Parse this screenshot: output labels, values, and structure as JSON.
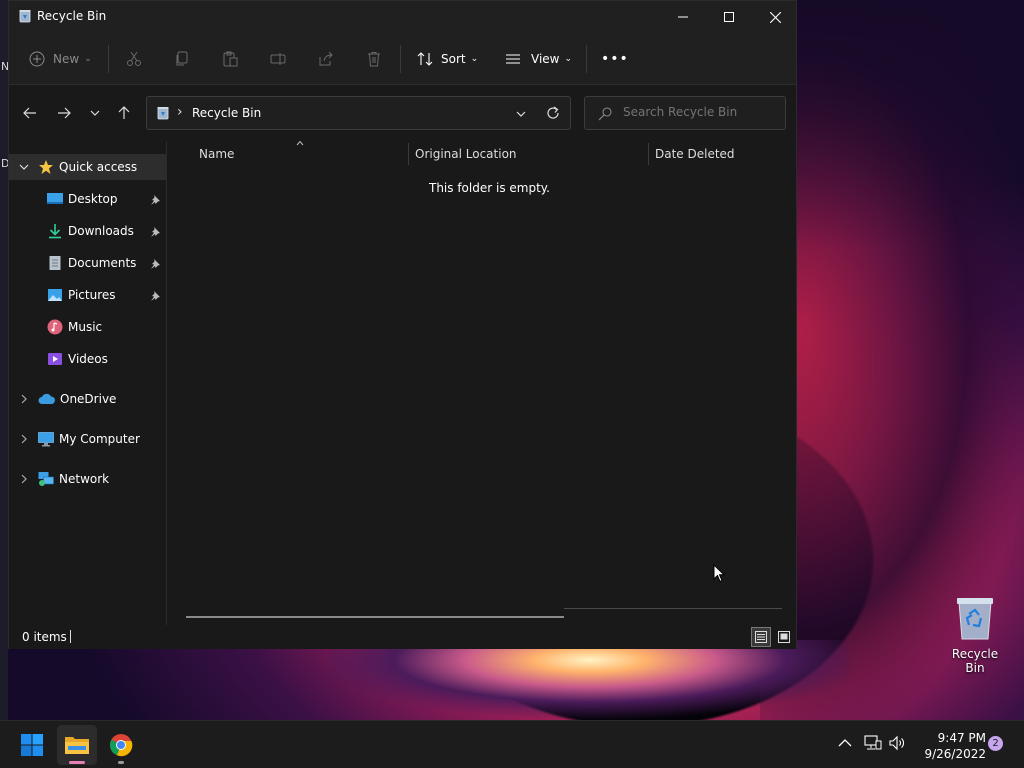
{
  "desktop": {
    "edge_letters": [
      "N",
      "D"
    ],
    "recycle_bin_label": "Recycle Bin"
  },
  "window": {
    "title": "Recycle Bin",
    "controls": {
      "minimize": "minimize",
      "maximize": "maximize",
      "close": "close"
    }
  },
  "toolbar": {
    "new_label": "New",
    "sort_label": "Sort",
    "view_label": "View",
    "more_label": "•••",
    "icons": [
      "cut-icon",
      "copy-icon",
      "paste-icon",
      "rename-icon",
      "share-icon",
      "delete-icon"
    ]
  },
  "address": {
    "path": "Recycle Bin",
    "separator": "›",
    "search_placeholder": "Search Recycle Bin"
  },
  "nav": {
    "quick_access": "Quick access",
    "pinned": [
      {
        "label": "Desktop",
        "pinned": true
      },
      {
        "label": "Downloads",
        "pinned": true
      },
      {
        "label": "Documents",
        "pinned": true
      },
      {
        "label": "Pictures",
        "pinned": true
      },
      {
        "label": "Music",
        "pinned": false
      },
      {
        "label": "Videos",
        "pinned": false
      }
    ],
    "onedrive": "OneDrive",
    "my_computer": "My Computer",
    "network": "Network"
  },
  "columns": {
    "name": "Name",
    "original_location": "Original Location",
    "date_deleted": "Date Deleted"
  },
  "content": {
    "empty_message": "This folder is empty."
  },
  "status": {
    "items": "0 items"
  },
  "taskbar": {
    "time": "9:47 PM",
    "date": "9/26/2022",
    "notification_count": "2"
  },
  "colors": {
    "window_bg": "#191919",
    "titlebar_bg": "#202020",
    "taskbar_bg": "#1c1c1c",
    "accent_folder": "#f4c542",
    "windows_blue": "#1f8ef1"
  }
}
